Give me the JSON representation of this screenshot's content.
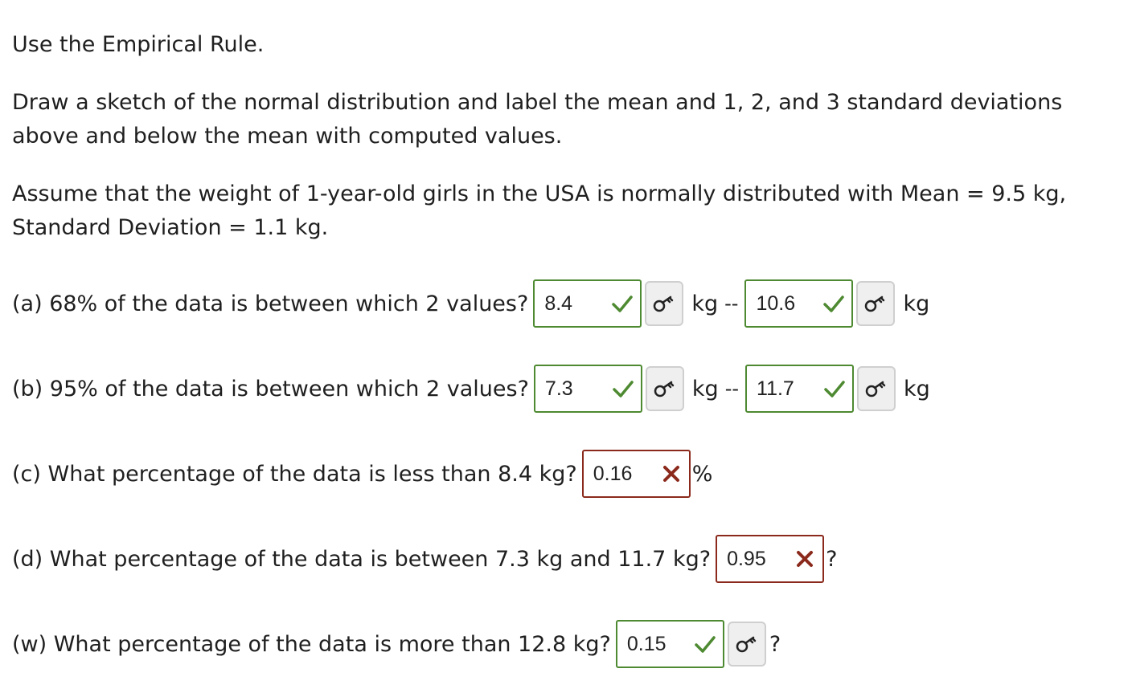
{
  "intro": {
    "line1": "Use the Empirical Rule.",
    "line2": "Draw a sketch of the normal distribution and label the mean and 1, 2, and 3 standard deviations",
    "line3": "above and below the mean with computed values.",
    "line4": "Assume that the weight of 1-year-old girls in the USA is normally distributed with Mean = 9.5 kg,",
    "line5": "Standard Deviation = 1.1 kg."
  },
  "questions": {
    "a": {
      "prompt": "(a) 68% of the data is between which 2 values?",
      "value1": "8.4",
      "unit1": "kg",
      "separator": "--",
      "value2": "10.6",
      "unit2": "kg",
      "status": "correct"
    },
    "b": {
      "prompt": "(b) 95% of the data is between which 2 values?",
      "value1": "7.3",
      "unit1": "kg",
      "separator": "--",
      "value2": "11.7",
      "unit2": "kg",
      "status": "correct"
    },
    "c": {
      "prompt": "(c) What percentage of the data is less than 8.4 kg?",
      "value": "0.16",
      "unit": "%",
      "status": "incorrect"
    },
    "d": {
      "prompt": "(d) What percentage of the data is between 7.3 kg and 11.7 kg?",
      "value": "0.95",
      "unit": "?",
      "status": "incorrect"
    },
    "w": {
      "prompt": "(w) What percentage of the data is more than 12.8 kg?",
      "value": "0.15",
      "unit": "?",
      "status": "correct"
    }
  },
  "colors": {
    "correct": "#4e8a31",
    "incorrect": "#8b2a1c"
  },
  "icons": {
    "correct": "check-icon",
    "incorrect": "cross-icon",
    "key": "key-icon"
  }
}
